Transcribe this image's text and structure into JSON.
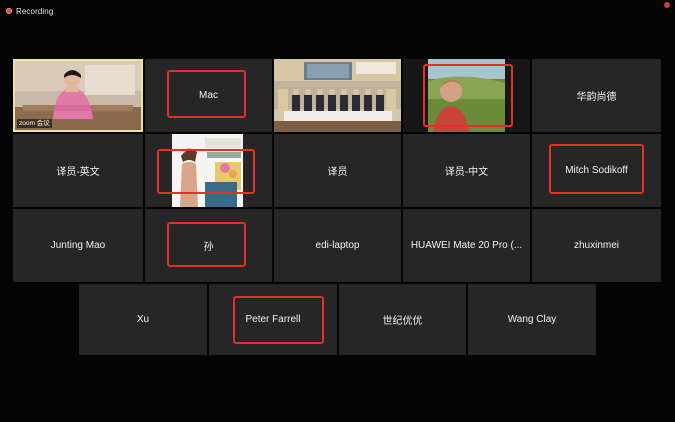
{
  "recording": {
    "label": "Recording",
    "color": "#e64940"
  },
  "highlight_color": "#e5302a",
  "tiles": {
    "r1": {
      "host_video_label": "zoom 会议",
      "mac": "Mac",
      "huayun": "华韵尚德"
    },
    "r2": {
      "yiyuan_en": "译员-英文",
      "yiyuan": "译员",
      "yiyuan_zh": "译员-中文",
      "mitch": "Mitch Sodikoff"
    },
    "r3": {
      "junting": "Junting Mao",
      "sun": "孙",
      "edi": "edi-laptop",
      "huawei": "HUAWEI Mate 20 Pro (...",
      "zhuxinmei": "zhuxinmei"
    },
    "r4": {
      "xu": "Xu",
      "peter": "Peter  Farrell",
      "shiji": "世纪优优",
      "wang": "Wang Clay"
    }
  }
}
